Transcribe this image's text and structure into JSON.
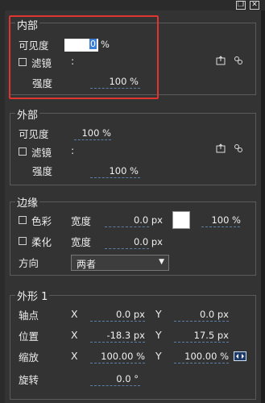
{
  "window": {
    "restore_icon": "restore-window-icon",
    "close_icon": "close-icon"
  },
  "inner": {
    "title": "内部",
    "visibility_label": "可见度",
    "visibility_value": "0",
    "visibility_unit": "%",
    "filter_label": "滤镜",
    "filter_colon": ":",
    "strength_label": "强度",
    "strength_value": "100 %"
  },
  "outer": {
    "title": "外部",
    "visibility_label": "可见度",
    "visibility_value": "100 %",
    "filter_label": "滤镜",
    "filter_colon": ":",
    "strength_label": "强度",
    "strength_value": "100 %"
  },
  "border": {
    "title": "边缘",
    "color_label": "色彩",
    "width_label": "宽度",
    "width_value": "0.0 px",
    "color_percent": "100 %",
    "soften_label": "柔化",
    "soften_width_label": "宽度",
    "soften_width_value": "0.0 px",
    "direction_label": "方向",
    "direction_value": "两者"
  },
  "shape": {
    "title": "外形 1",
    "axis_label": "轴点",
    "axis_x_label": "X",
    "axis_x_value": "0.0 px",
    "axis_y_label": "Y",
    "axis_y_value": "0.0 px",
    "pos_label": "位置",
    "pos_x_label": "X",
    "pos_x_value": "-18.3 px",
    "pos_y_label": "Y",
    "pos_y_value": "17.5 px",
    "scale_label": "缩放",
    "scale_x_label": "X",
    "scale_x_value": "100.00 %",
    "scale_y_label": "Y",
    "scale_y_value": "100.00 %",
    "rotate_label": "旋转",
    "rotate_value": "0.0 °"
  },
  "colors": {
    "highlight": "#e0342e",
    "underline": "#5b7fa8",
    "swatch": "#ffffff"
  }
}
